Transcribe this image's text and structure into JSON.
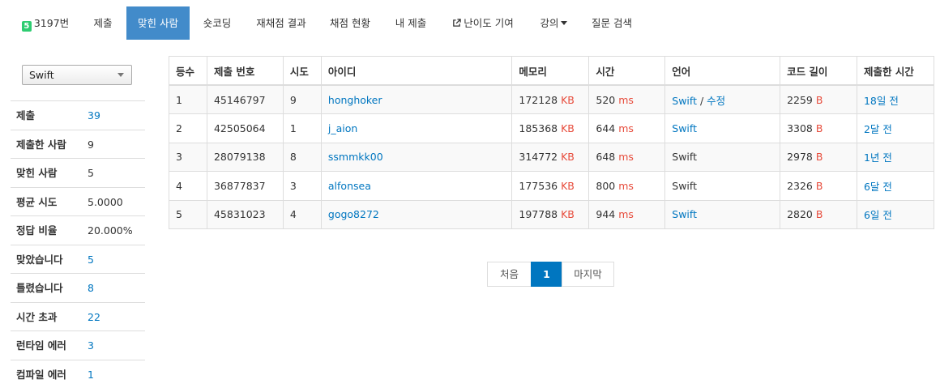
{
  "nav": {
    "problem_label": "3197번",
    "problem_badge": "5",
    "items": [
      {
        "label": "제출"
      },
      {
        "label": "맞힌 사람"
      },
      {
        "label": "숏코딩"
      },
      {
        "label": "재채점 결과"
      },
      {
        "label": "채점 현황"
      },
      {
        "label": "내 제출"
      },
      {
        "label": "난이도 기여"
      },
      {
        "label": "강의"
      },
      {
        "label": "질문 검색"
      }
    ],
    "active_index": 1
  },
  "language_filter": {
    "selected": "Swift"
  },
  "stats": [
    {
      "label": "제출",
      "value": "39"
    },
    {
      "label": "제출한 사람",
      "value": "9"
    },
    {
      "label": "맞힌 사람",
      "value": "5"
    },
    {
      "label": "평균 시도",
      "value": "5.0000"
    },
    {
      "label": "정답 비율",
      "value": "20.000%"
    },
    {
      "label": "맞았습니다",
      "value": "5"
    },
    {
      "label": "틀렸습니다",
      "value": "8"
    },
    {
      "label": "시간 초과",
      "value": "22"
    },
    {
      "label": "런타임 에러",
      "value": "3"
    },
    {
      "label": "컴파일 에러",
      "value": "1"
    }
  ],
  "table": {
    "headers": [
      "등수",
      "제출 번호",
      "시도",
      "아이디",
      "메모리",
      "시간",
      "언어",
      "코드 길이",
      "제출한 시간"
    ],
    "units": {
      "memory": "KB",
      "time": "ms",
      "length": "B"
    },
    "edit_label": "수정",
    "rows": [
      {
        "rank": "1",
        "submission": "45146797",
        "tries": "9",
        "user": "honghoker",
        "memory": "172128",
        "time": "520",
        "language": "Swift",
        "edit": true,
        "length": "2259",
        "submitted": "18일 전"
      },
      {
        "rank": "2",
        "submission": "42505064",
        "tries": "1",
        "user": "j_aion",
        "memory": "185368",
        "time": "644",
        "language": "Swift",
        "edit": false,
        "length": "3308",
        "submitted": "2달 전"
      },
      {
        "rank": "3",
        "submission": "28079138",
        "tries": "8",
        "user": "ssmmkk00",
        "memory": "314772",
        "time": "648",
        "language": "Swift",
        "edit": false,
        "length": "2978",
        "submitted": "1년 전"
      },
      {
        "rank": "4",
        "submission": "36877837",
        "tries": "3",
        "user": "alfonsea",
        "memory": "177536",
        "time": "800",
        "language": "Swift",
        "edit": false,
        "length": "2326",
        "submitted": "6달 전"
      },
      {
        "rank": "5",
        "submission": "45831023",
        "tries": "4",
        "user": "gogo8272",
        "memory": "197788",
        "time": "944",
        "language": "Swift",
        "edit": false,
        "length": "2820",
        "submitted": "6일 전"
      }
    ]
  },
  "pagination": {
    "first": "처음",
    "current": "1",
    "last": "마지막"
  },
  "colors": {
    "accent": "#428bca",
    "link": "#0076c0",
    "unit": "#e74c3c",
    "badge": "#2ecc71"
  }
}
